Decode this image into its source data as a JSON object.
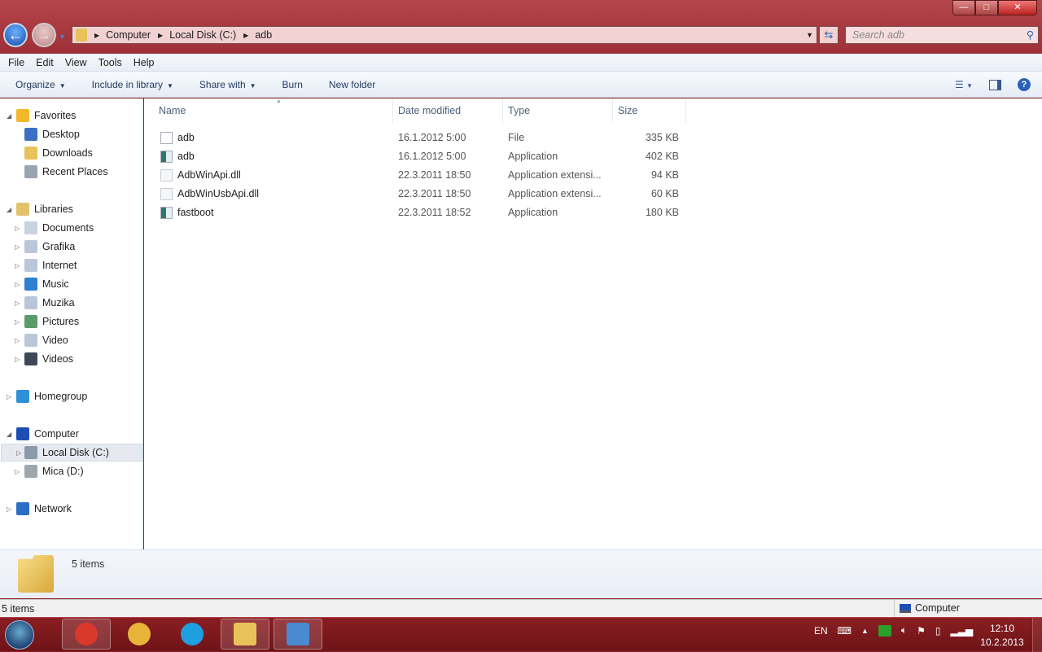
{
  "window": {
    "minimize": "—",
    "maximize": "□",
    "close": "✕"
  },
  "address": {
    "crumbs": [
      "Computer",
      "Local Disk (C:)",
      "adb"
    ]
  },
  "search": {
    "placeholder": "Search adb"
  },
  "menu": [
    "File",
    "Edit",
    "View",
    "Tools",
    "Help"
  ],
  "commands": [
    {
      "label": "Organize",
      "dropdown": true
    },
    {
      "label": "Include in library",
      "dropdown": true
    },
    {
      "label": "Share with",
      "dropdown": true
    },
    {
      "label": "Burn",
      "dropdown": false
    },
    {
      "label": "New folder",
      "dropdown": false
    }
  ],
  "sidebar": [
    {
      "label": "Favorites",
      "level": 0,
      "expanded": true,
      "icon": "star-icon",
      "color": "#f2b827"
    },
    {
      "label": "Desktop",
      "level": 1,
      "icon": "desktop-icon",
      "color": "#3b6fc4"
    },
    {
      "label": "Downloads",
      "level": 1,
      "icon": "downloads-folder-icon",
      "color": "#e8c35a"
    },
    {
      "label": "Recent Places",
      "level": 1,
      "icon": "recent-places-icon",
      "color": "#9aa4b0"
    },
    null,
    {
      "label": "Libraries",
      "level": 0,
      "expanded": true,
      "icon": "libraries-icon",
      "color": "#e3c36a"
    },
    {
      "label": "Documents",
      "level": 1,
      "collapsed": true,
      "icon": "documents-icon",
      "color": "#c9d3df"
    },
    {
      "label": "Grafika",
      "level": 1,
      "collapsed": true,
      "icon": "library-icon",
      "color": "#b9c7d8"
    },
    {
      "label": "Internet",
      "level": 1,
      "collapsed": true,
      "icon": "library-icon",
      "color": "#b9c7d8"
    },
    {
      "label": "Music",
      "level": 1,
      "collapsed": true,
      "icon": "music-icon",
      "color": "#2f7fd1"
    },
    {
      "label": "Muzika",
      "level": 1,
      "collapsed": true,
      "icon": "library-icon",
      "color": "#b9c7d8"
    },
    {
      "label": "Pictures",
      "level": 1,
      "collapsed": true,
      "icon": "pictures-icon",
      "color": "#5b9b6a"
    },
    {
      "label": "Video",
      "level": 1,
      "collapsed": true,
      "icon": "library-icon",
      "color": "#b9c7d8"
    },
    {
      "label": "Videos",
      "level": 1,
      "collapsed": true,
      "icon": "videos-icon",
      "color": "#3d4756"
    },
    null,
    {
      "label": "Homegroup",
      "level": 0,
      "collapsed": true,
      "icon": "homegroup-icon",
      "color": "#2f8fd8"
    },
    null,
    {
      "label": "Computer",
      "level": 0,
      "expanded": true,
      "icon": "computer-icon",
      "color": "#1d4fb2"
    },
    {
      "label": "Local Disk (C:)",
      "level": 1,
      "collapsed": true,
      "selected": true,
      "icon": "local-disk-icon",
      "color": "#8a9aa8"
    },
    {
      "label": "Mica (D:)",
      "level": 1,
      "collapsed": true,
      "icon": "drive-icon",
      "color": "#a0a6ad"
    },
    null,
    {
      "label": "Network",
      "level": 0,
      "collapsed": true,
      "icon": "network-icon",
      "color": "#2a6fc4"
    }
  ],
  "columns": [
    "Name",
    "Date modified",
    "Type",
    "Size"
  ],
  "files": [
    {
      "name": "adb",
      "date": "16.1.2012 5:00",
      "type": "File",
      "size": "335 KB",
      "kind": "file"
    },
    {
      "name": "adb",
      "date": "16.1.2012 5:00",
      "type": "Application",
      "size": "402 KB",
      "kind": "app"
    },
    {
      "name": "AdbWinApi.dll",
      "date": "22.3.2011 18:50",
      "type": "Application extensi...",
      "size": "94 KB",
      "kind": "dll"
    },
    {
      "name": "AdbWinUsbApi.dll",
      "date": "22.3.2011 18:50",
      "type": "Application extensi...",
      "size": "60 KB",
      "kind": "dll"
    },
    {
      "name": "fastboot",
      "date": "22.3.2011 18:52",
      "type": "Application",
      "size": "180 KB",
      "kind": "app"
    }
  ],
  "details": {
    "count": "5 items"
  },
  "status": {
    "left": "5 items",
    "right": "Computer"
  },
  "taskbar": [
    {
      "name": "chrome",
      "color": "#d9382a",
      "open": true
    },
    {
      "name": "outlook",
      "color": "#e8b43a",
      "open": false
    },
    {
      "name": "skype",
      "color": "#1e9fe0",
      "open": false
    },
    {
      "name": "windows-explorer",
      "color": "#e8c35a",
      "open": true
    },
    {
      "name": "remote-desktop",
      "color": "#4a8ad0",
      "open": true
    }
  ],
  "tray": {
    "lang": "EN",
    "time": "12:10",
    "date": "10.2.2013"
  }
}
